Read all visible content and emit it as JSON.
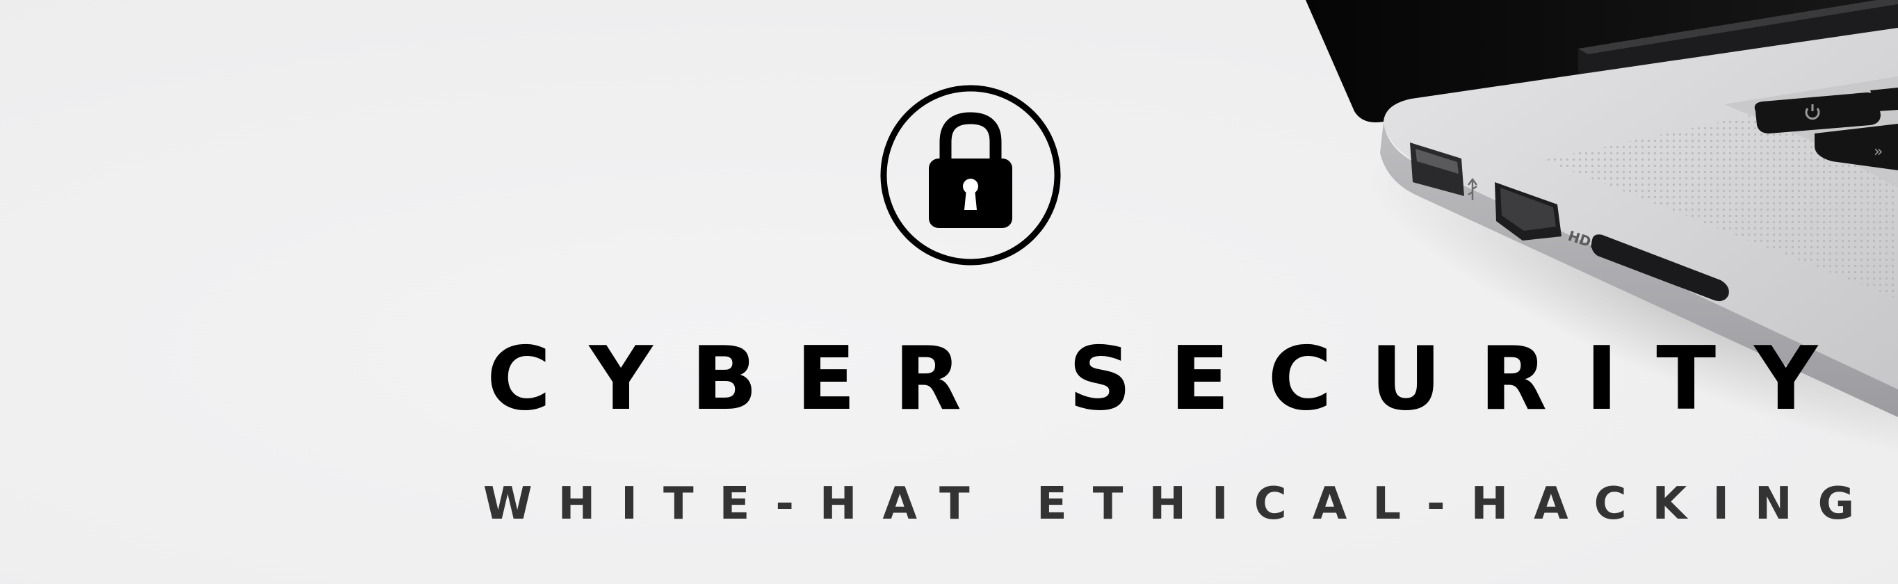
{
  "banner": {
    "title": "CYBER SECURITY",
    "subtitle": "WHITE-HAT ETHICAL-HACKING",
    "icon": "lock-icon",
    "image": "laptop-photo",
    "colors": {
      "background": "#f1f1f2",
      "title": "#000000",
      "subtitle": "#333333",
      "laptop_body": "#d4d4d6",
      "laptop_screen": "#0b0b0c",
      "keys": "#1a1a1a"
    }
  }
}
